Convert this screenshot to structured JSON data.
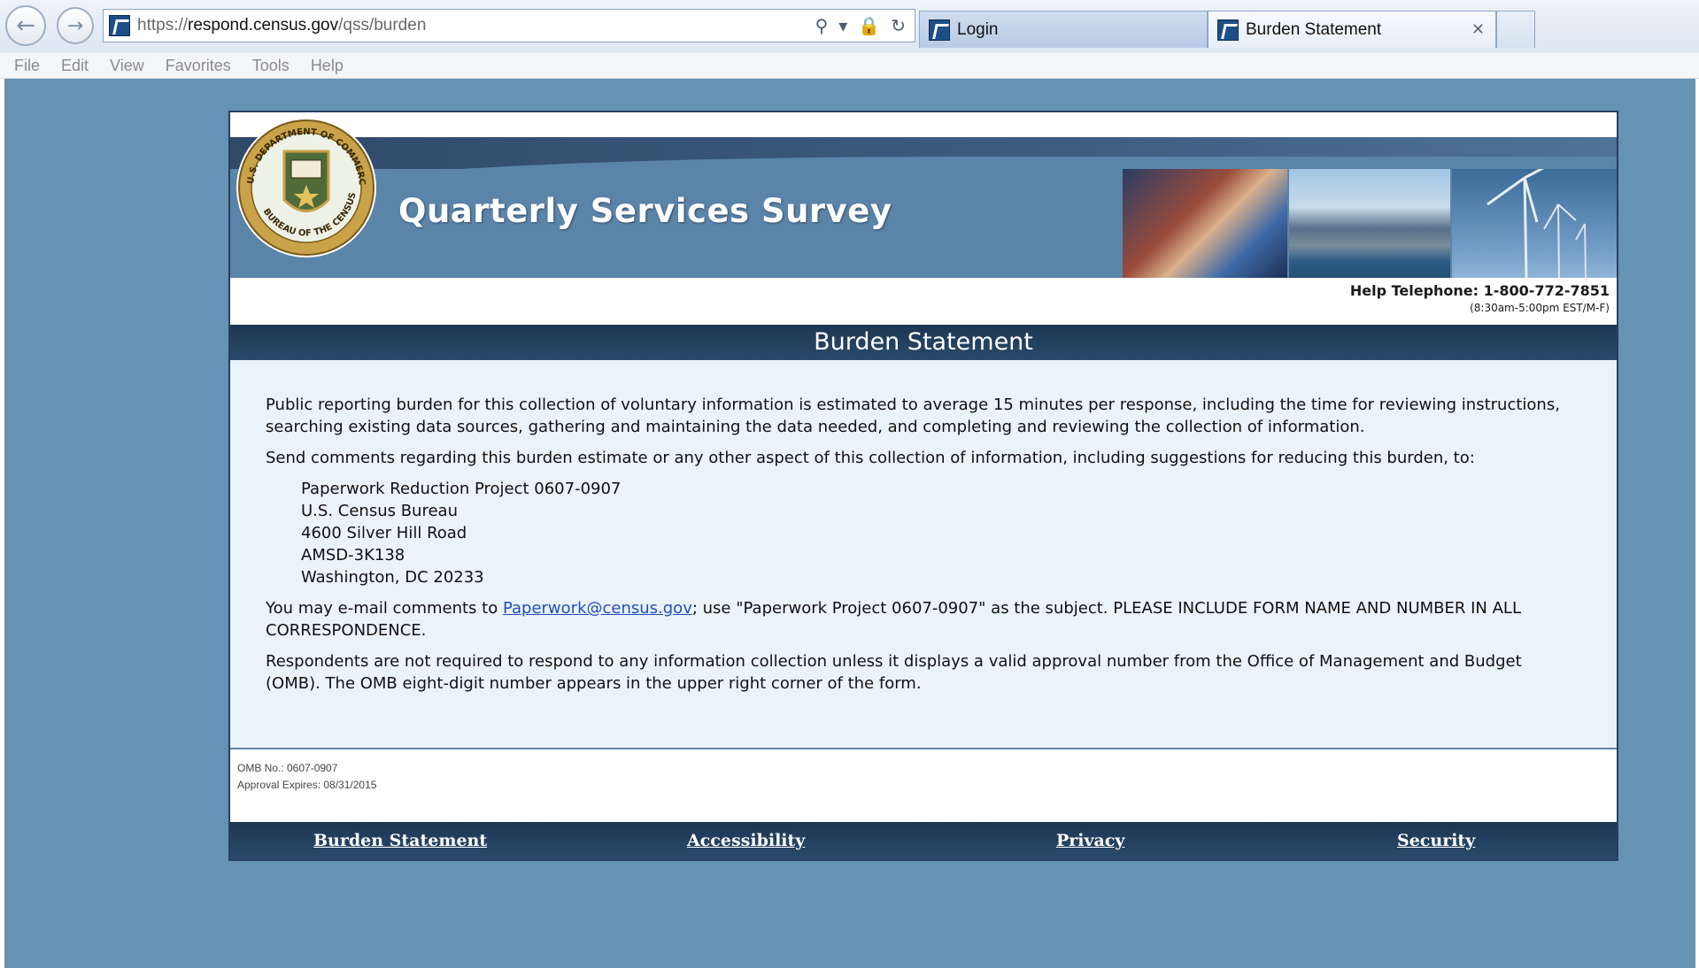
{
  "browser": {
    "url_scheme": "https://",
    "url_host": "respond.census.gov",
    "url_path": "/qss/burden",
    "tabs": [
      {
        "label": "Login"
      },
      {
        "label": "Burden Statement"
      }
    ],
    "menu": [
      "File",
      "Edit",
      "View",
      "Favorites",
      "Tools",
      "Help"
    ]
  },
  "header": {
    "title": "Quarterly Services Survey",
    "seal_top_text": "U.S. DEPARTMENT OF COMMERCE",
    "seal_bottom_text": "BUREAU OF THE CENSUS",
    "help_telephone": "Help Telephone: 1-800-772-7851",
    "help_hours": "(8:30am-5:00pm EST/M-F)"
  },
  "page": {
    "heading": "Burden Statement",
    "para1": "Public reporting burden for this collection of voluntary information is estimated to average 15 minutes per response, including the time for reviewing instructions, searching existing data sources, gathering and maintaining the data needed, and completing and reviewing the collection of information.",
    "para2": "Send comments regarding this burden estimate or any other aspect of this collection of information, including suggestions for reducing this burden, to:",
    "address": [
      "Paperwork Reduction Project 0607-0907",
      "U.S. Census Bureau",
      "4600 Silver Hill Road",
      "AMSD-3K138",
      "Washington, DC 20233"
    ],
    "email_prefix": "You may e-mail comments to ",
    "email_link": "Paperwork@census.gov",
    "email_suffix": "; use \"Paperwork Project 0607-0907\" as the subject. PLEASE INCLUDE FORM NAME AND NUMBER IN ALL CORRESPONDENCE.",
    "para4": "Respondents are not required to respond to any information collection unless it displays a valid approval number from the Office of Management and Budget (OMB). The OMB eight-digit number appears in the upper right corner of the form."
  },
  "omb": {
    "number": "OMB No.: 0607-0907",
    "expires": "Approval Expires: 08/31/2015"
  },
  "footer": {
    "links": [
      "Burden Statement",
      "Accessibility",
      "Privacy",
      "Security"
    ]
  },
  "colors": {
    "viewport_bg": "#6693b4",
    "banner_bg": "#5b84a9",
    "bar_dark": "#1c3652",
    "content_bg": "#eaf2fa",
    "link": "#1f4fc0"
  }
}
